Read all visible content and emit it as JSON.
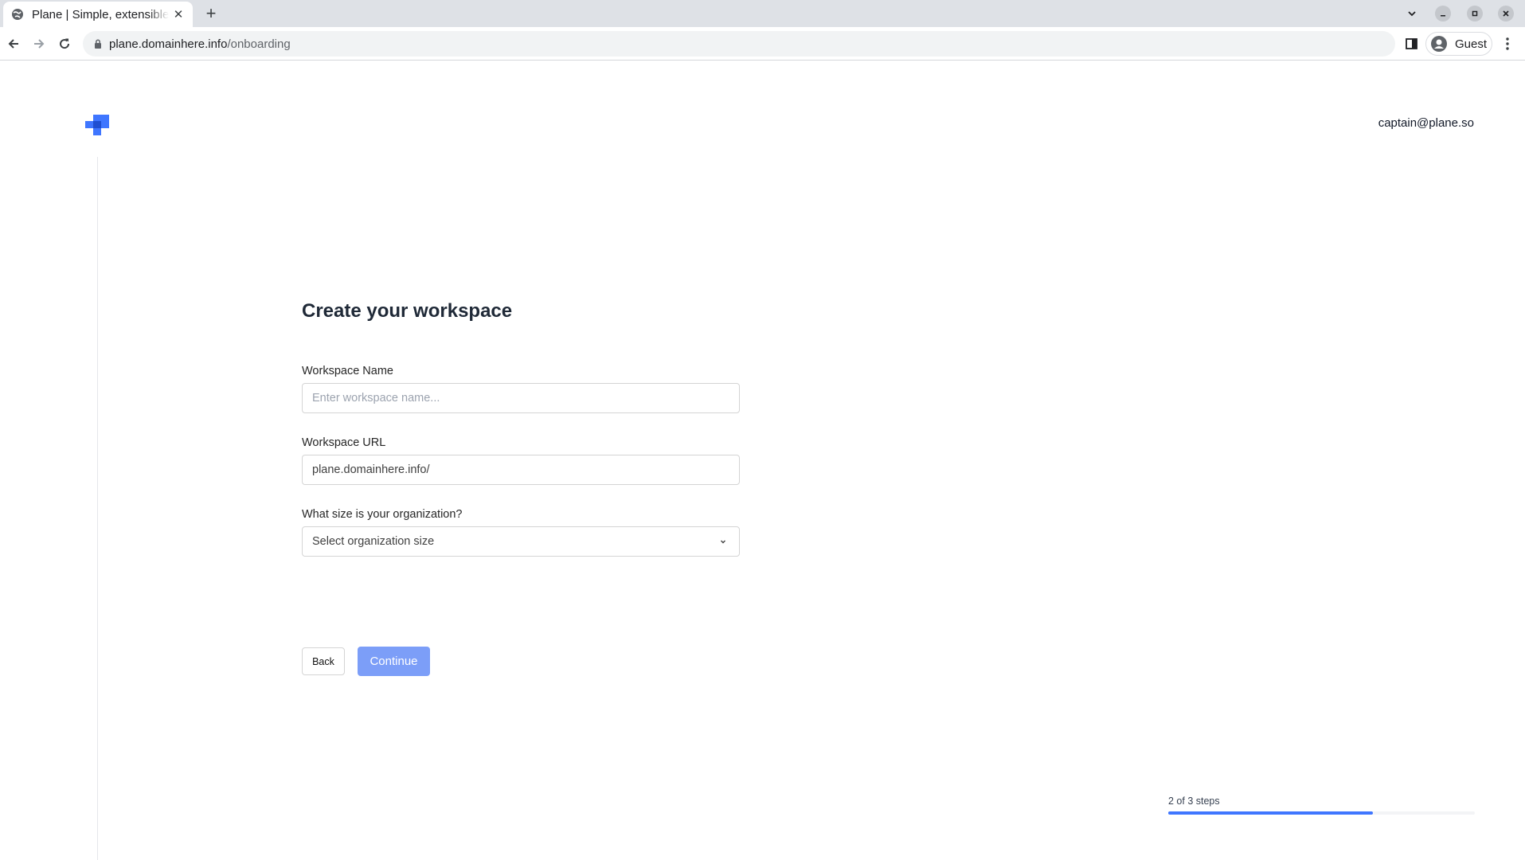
{
  "browser": {
    "tab_title": "Plane | Simple, extensible, open-source project management tool",
    "url_host": "plane.domainhere.info",
    "url_path": "/onboarding",
    "profile_label": "Guest"
  },
  "header": {
    "logo_icon": "plane-logo",
    "user_email": "captain@plane.so"
  },
  "form": {
    "title": "Create your workspace",
    "name_label": "Workspace Name",
    "name_placeholder": "Enter workspace name...",
    "url_label": "Workspace URL",
    "url_value": "plane.domainhere.info/",
    "size_label": "What size is your organization?",
    "size_placeholder": "Select organization size",
    "back_label": "Back",
    "continue_label": "Continue"
  },
  "progress": {
    "label": "2 of 3 steps",
    "current_step": 2,
    "total_steps": 3,
    "fraction": 0.667
  },
  "colors": {
    "accent": "#3f76ff",
    "continue_disabled": "#7c9ef8"
  }
}
